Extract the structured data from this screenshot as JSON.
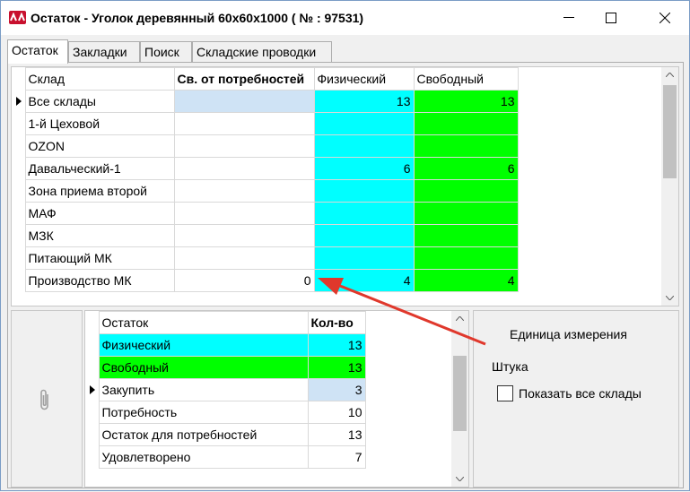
{
  "window": {
    "title": "Остаток - Уголок деревянный 60x60x1000 ( № : 97531)",
    "min_glyph": "—",
    "max_glyph": "☐",
    "close_glyph": "✕"
  },
  "tabs": [
    {
      "label": "Остаток",
      "active": true
    },
    {
      "label": "Закладки",
      "active": false
    },
    {
      "label": "Поиск",
      "active": false
    },
    {
      "label": "Складские проводки",
      "active": false
    }
  ],
  "stock_grid": {
    "columns": [
      "Склад",
      "Св. от потребностей",
      "Физический",
      "Свободный"
    ],
    "rows": [
      {
        "warehouse": "Все склады",
        "free_from_needs": "",
        "physical": "13",
        "free": "13"
      },
      {
        "warehouse": "1-й Цеховой",
        "free_from_needs": "",
        "physical": "",
        "free": ""
      },
      {
        "warehouse": "OZON",
        "free_from_needs": "",
        "physical": "",
        "free": ""
      },
      {
        "warehouse": "Давальческий-1",
        "free_from_needs": "",
        "physical": "6",
        "free": "6"
      },
      {
        "warehouse": "Зона приема второй",
        "free_from_needs": "",
        "physical": "",
        "free": ""
      },
      {
        "warehouse": "МАФ",
        "free_from_needs": "",
        "physical": "",
        "free": ""
      },
      {
        "warehouse": "МЗК",
        "free_from_needs": "",
        "physical": "",
        "free": ""
      },
      {
        "warehouse": "Питающий МК",
        "free_from_needs": "",
        "physical": "",
        "free": ""
      },
      {
        "warehouse": "Производство МК",
        "free_from_needs": "0",
        "physical": "4",
        "free": "4"
      }
    ]
  },
  "summary_grid": {
    "columns": [
      "Остаток",
      "Кол-во"
    ],
    "rows": [
      {
        "label": "Физический",
        "qty": "13"
      },
      {
        "label": "Свободный",
        "qty": "13"
      },
      {
        "label": "Закупить",
        "qty": "3"
      },
      {
        "label": "Потребность",
        "qty": "10"
      },
      {
        "label": "Остаток для потребностей",
        "qty": "13"
      },
      {
        "label": "Удовлетворено",
        "qty": "7"
      }
    ]
  },
  "info": {
    "unit_caption": "Единица измерения",
    "unit_value": "Штука",
    "show_all_label": "Показать все склады"
  },
  "colors": {
    "physical": "#00ffff",
    "free": "#00ff00",
    "selected": "#cfe3f5",
    "annotation_arrow": "#e0382c",
    "app_icon": "#c8102e"
  }
}
